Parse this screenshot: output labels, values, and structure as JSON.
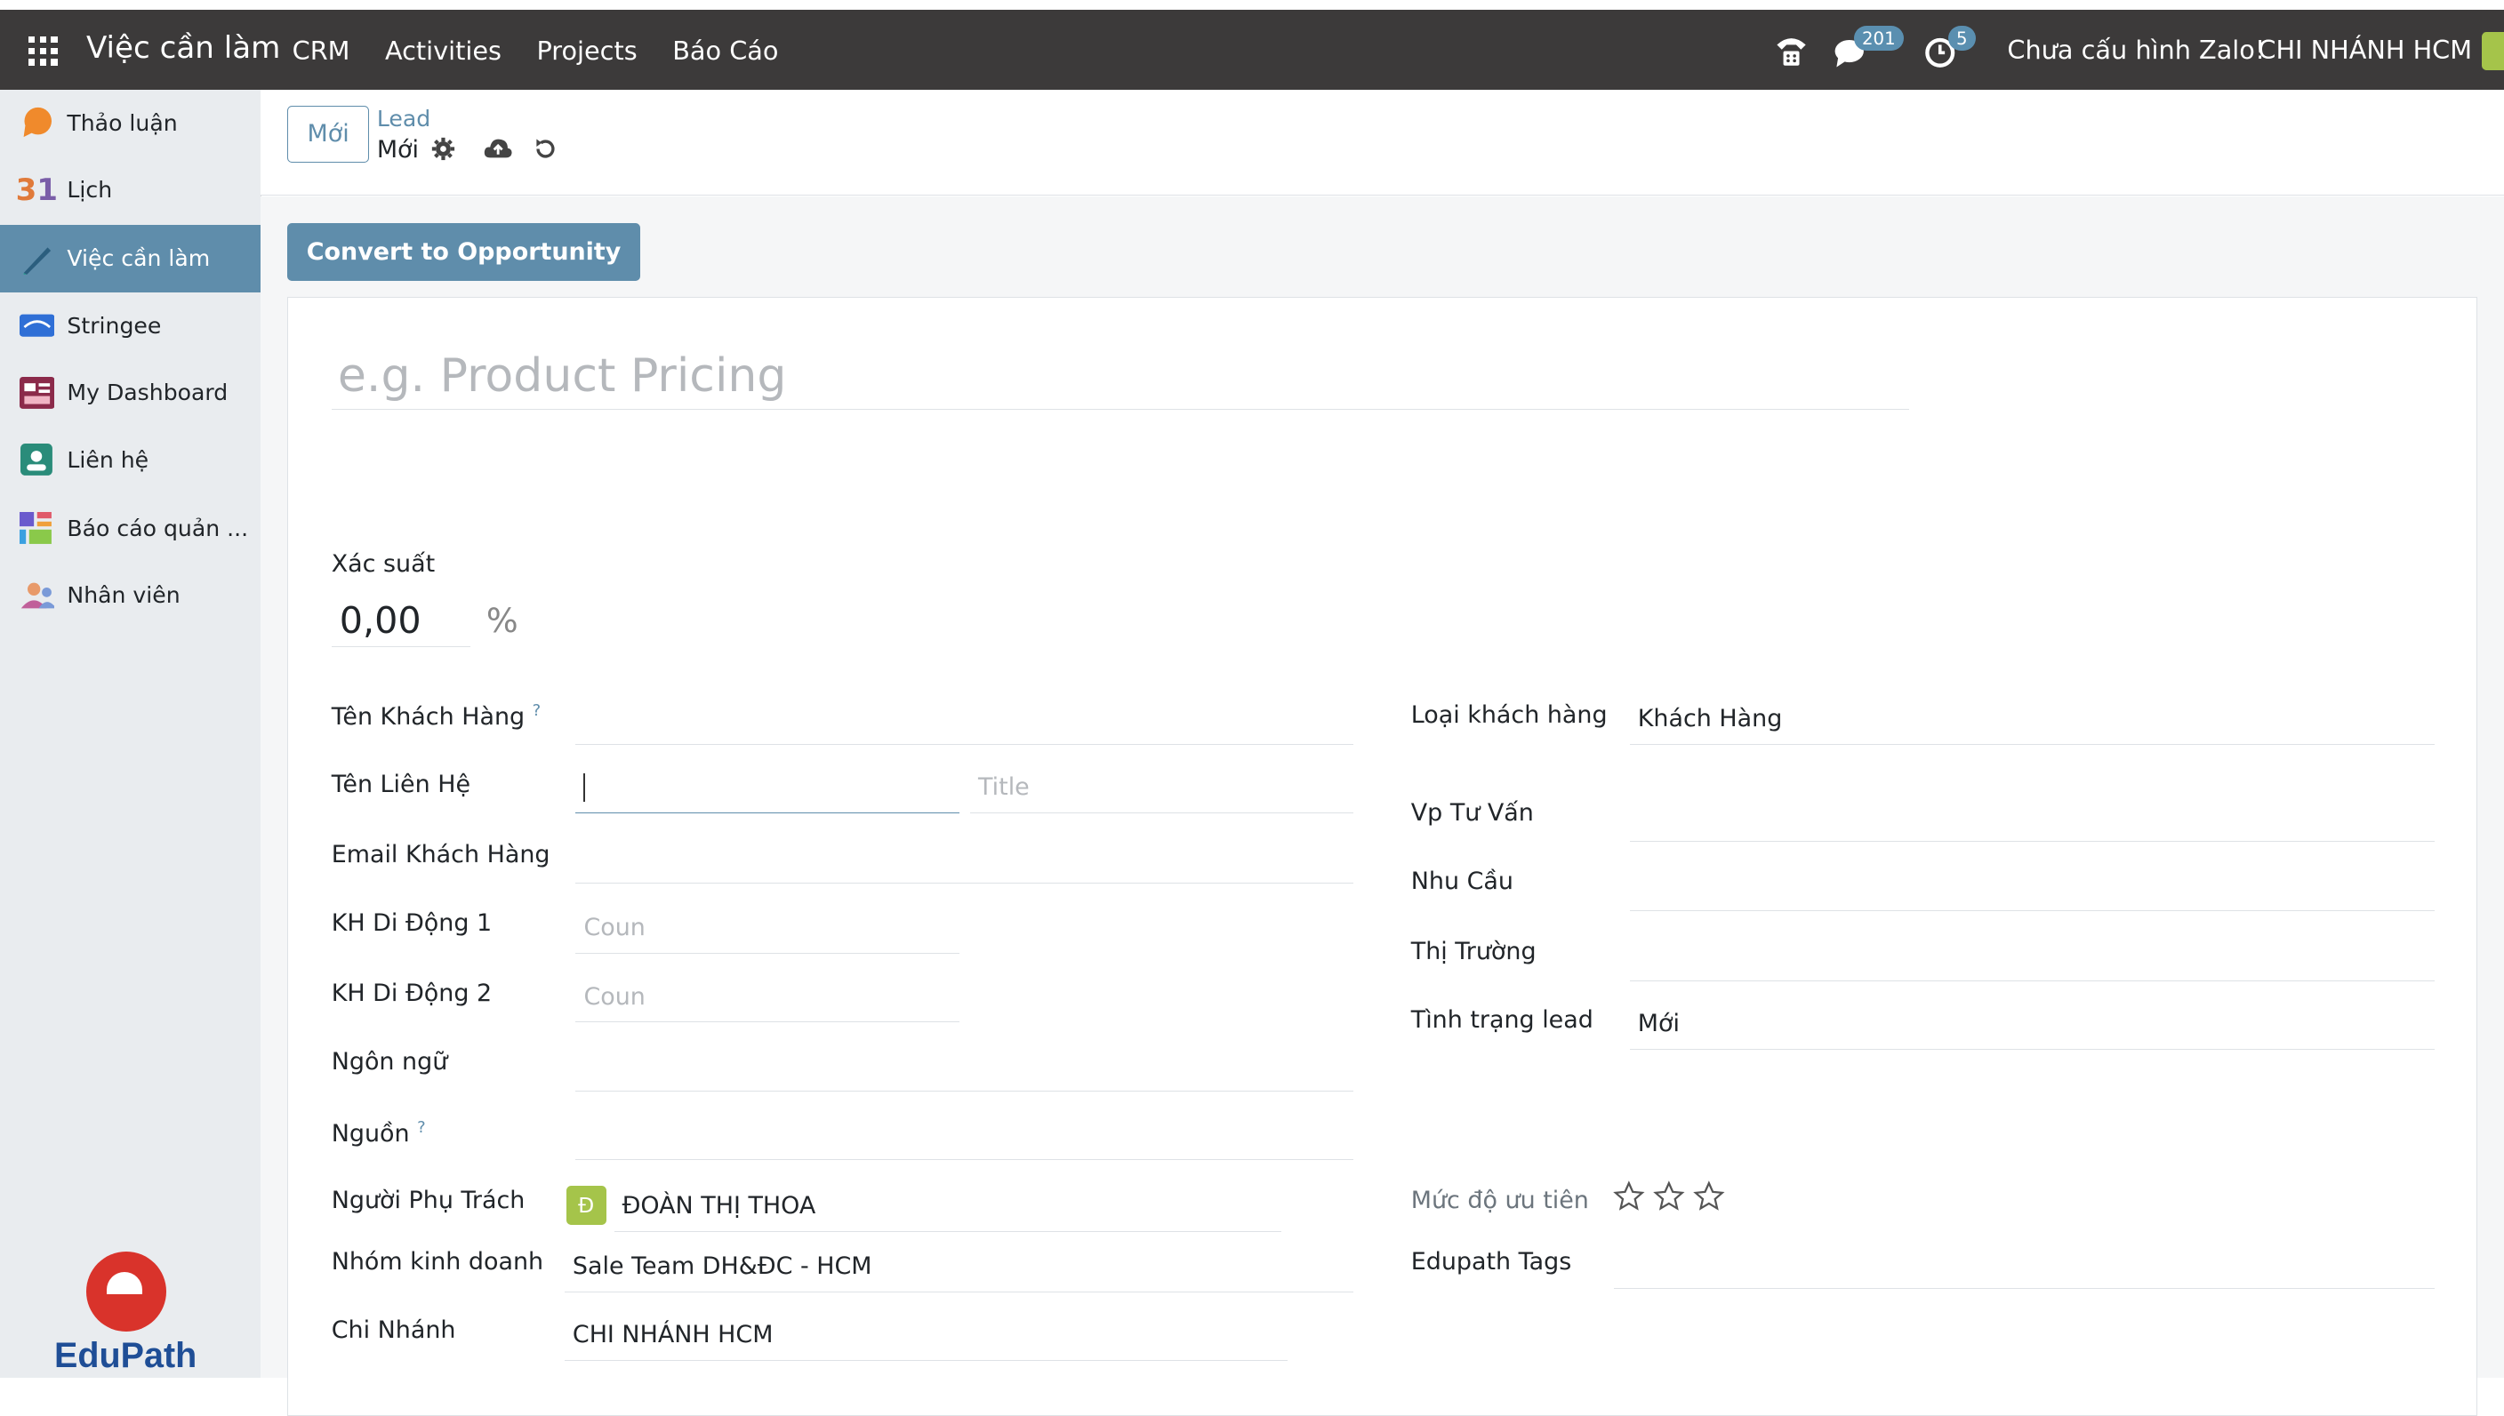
{
  "navbar": {
    "app_title": "Việc cần làm",
    "menu": [
      "CRM",
      "Activities",
      "Projects",
      "Báo Cáo"
    ],
    "messages_count": "201",
    "activities_count": "5",
    "zalo_status": "Chưa cấu hình Zalo!",
    "branch": "CHI NHÁNH HCM"
  },
  "sidebar": {
    "items": [
      {
        "label": "Thảo luận",
        "icon": "chat-bubble-icon"
      },
      {
        "label": "Lịch",
        "icon": "calendar-31-icon"
      },
      {
        "label": "Việc cần làm",
        "icon": "pen-icon"
      },
      {
        "label": "Stringee",
        "icon": "stringee-icon"
      },
      {
        "label": "My Dashboard",
        "icon": "dashboard-icon"
      },
      {
        "label": "Liên hệ",
        "icon": "contact-card-icon"
      },
      {
        "label": "Báo cáo quản ...",
        "icon": "report-blocks-icon"
      },
      {
        "label": "Nhân viên",
        "icon": "people-icon"
      }
    ],
    "active_index": 2,
    "logo_text": "EduPath"
  },
  "control": {
    "new_button": "Mới",
    "breadcrumb_parent": "Lead",
    "breadcrumb_current": "Mới"
  },
  "form": {
    "convert_button": "Convert to Opportunity",
    "title_placeholder": "e.g. Product Pricing",
    "probability_label": "Xác suất",
    "probability_value": "0,00",
    "probability_unit": "%",
    "left": {
      "customer_name_label": "Tên Khách Hàng",
      "customer_name_help": "?",
      "contact_name_label": "Tên Liên Hệ",
      "contact_title_placeholder": "Title",
      "email_label": "Email Khách Hàng",
      "mobile1_label": "KH Di Động 1",
      "mobile1_placeholder": "Coun",
      "mobile2_label": "KH Di Động 2",
      "mobile2_placeholder": "Coun",
      "language_label": "Ngôn ngữ",
      "source_label": "Nguồn",
      "source_help": "?",
      "owner_label": "Người Phụ Trách",
      "owner_initial": "Đ",
      "owner_value": "ĐOÀN THỊ THOA",
      "sales_team_label": "Nhóm kinh doanh",
      "sales_team_value": "Sale Team DH&ĐC - HCM",
      "branch_label": "Chi Nhánh",
      "branch_value": "CHI NHÁNH HCM"
    },
    "right": {
      "customer_type_label": "Loại khách hàng",
      "customer_type_value": "Khách Hàng",
      "office_label": "Vp Tư Vấn",
      "needs_label": "Nhu Cầu",
      "market_label": "Thị Trường",
      "lead_status_label": "Tình trạng lead",
      "lead_status_value": "Mới",
      "priority_label": "Mức độ ưu tiên",
      "priority_stars": 0,
      "tags_label": "Edupath Tags"
    }
  }
}
